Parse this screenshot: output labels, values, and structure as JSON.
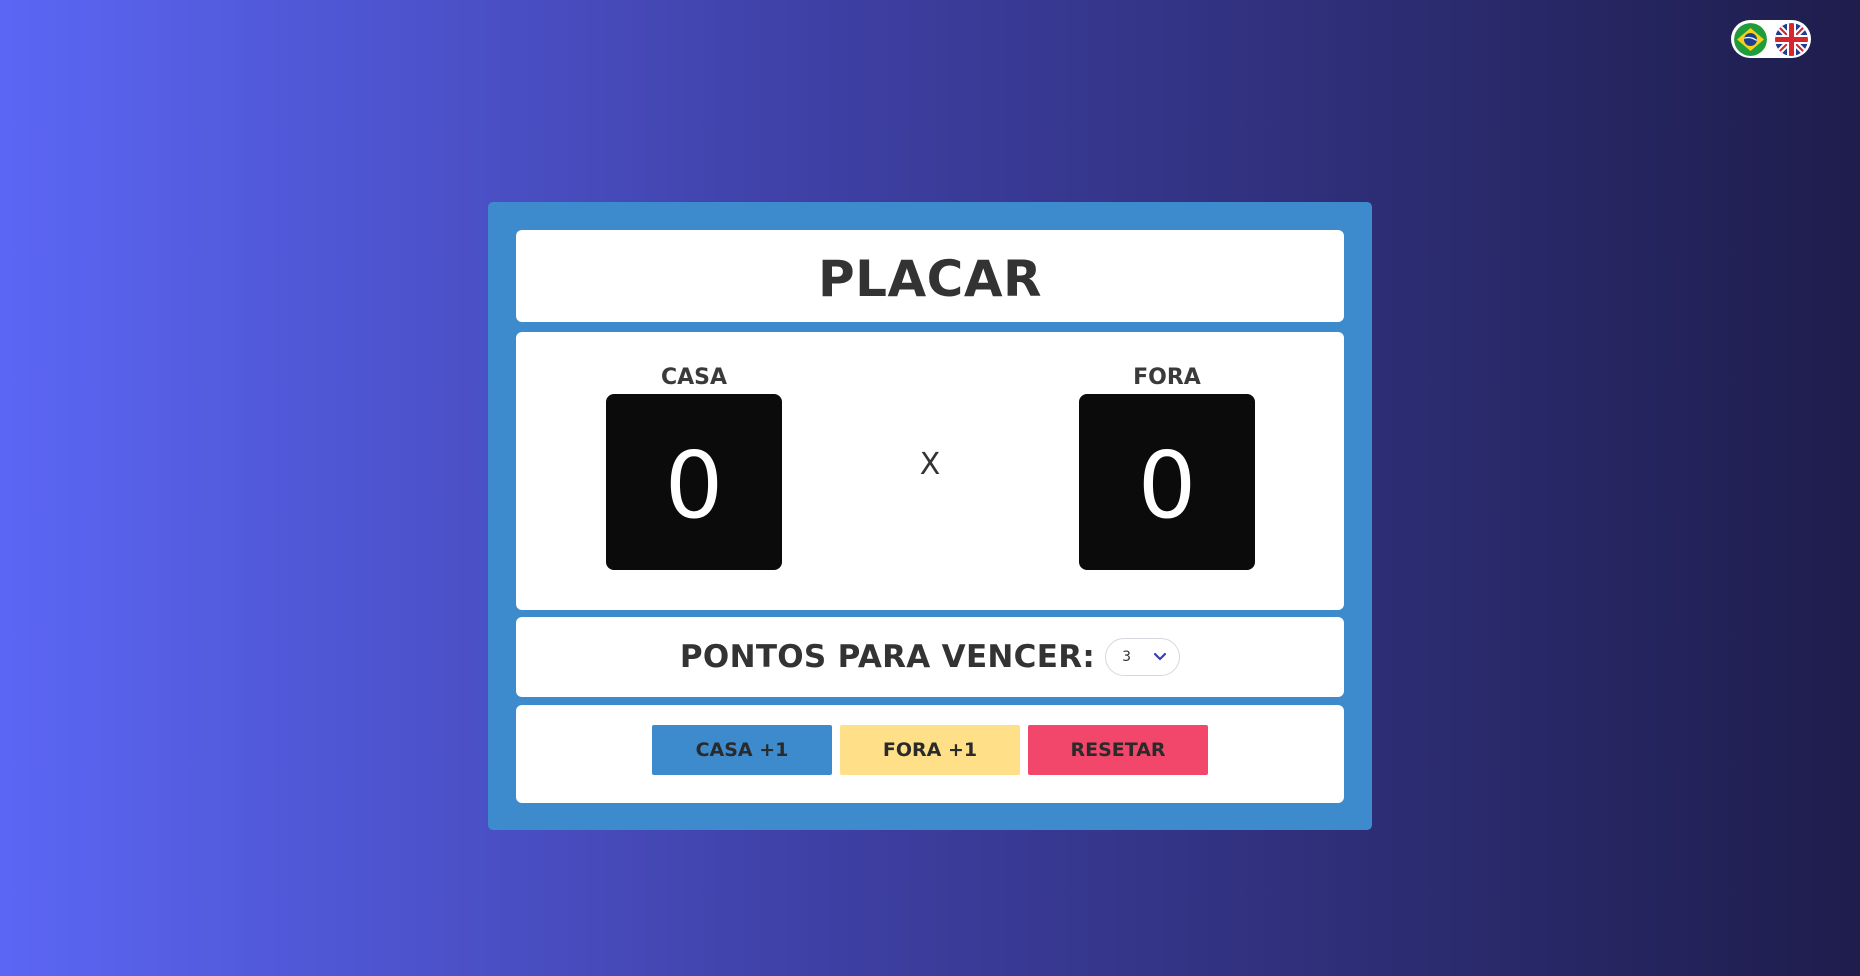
{
  "language_switcher": {
    "options": [
      {
        "name": "brazil-flag-icon",
        "lang": "pt-BR"
      },
      {
        "name": "uk-flag-icon",
        "lang": "en"
      }
    ]
  },
  "scoreboard": {
    "title": "PLACAR",
    "home": {
      "label": "CASA",
      "score": "0"
    },
    "separator": "X",
    "away": {
      "label": "FORA",
      "score": "0"
    }
  },
  "points_to_win": {
    "label": "PONTOS PARA VENCER:",
    "selected": "3"
  },
  "actions": {
    "home_plus_label": "CASA +1",
    "away_plus_label": "FORA +1",
    "reset_label": "RESETAR"
  },
  "colors": {
    "card": "#3d8bcd",
    "home_button": "#3d8bcd",
    "away_button": "#ffdf88",
    "reset_button": "#f2476b",
    "score_box": "#0b0b0b"
  }
}
